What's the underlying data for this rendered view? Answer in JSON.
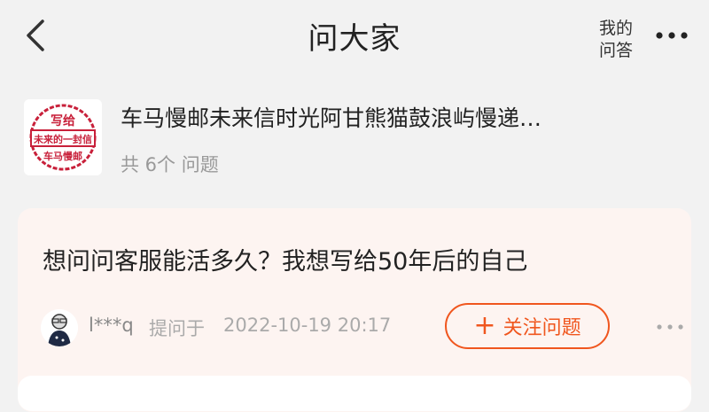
{
  "header": {
    "title": "问大家",
    "my_answers_line1": "我的",
    "my_answers_line2": "问答"
  },
  "product": {
    "logo_text": [
      "写给",
      "未来的一封信",
      "车马慢邮"
    ],
    "name": "车马慢邮未来信时光阿甘熊猫鼓浪屿慢递…",
    "count": "共 6个 问题"
  },
  "question_card": {
    "question": "想问问客服能活多久？我想写给50年后的自己",
    "asker_name": "l***q",
    "asked_prefix": "提问于",
    "asked_time": "2022-10-19 20:17",
    "follow_label": "关注问题"
  },
  "colors": {
    "accent": "#f0561e",
    "card_bg": "#fdf4f1",
    "logo_red": "#c8203a"
  },
  "icons": {
    "back": "chevron-left-icon",
    "more": "more-dots-icon",
    "plus": "plus-icon"
  }
}
